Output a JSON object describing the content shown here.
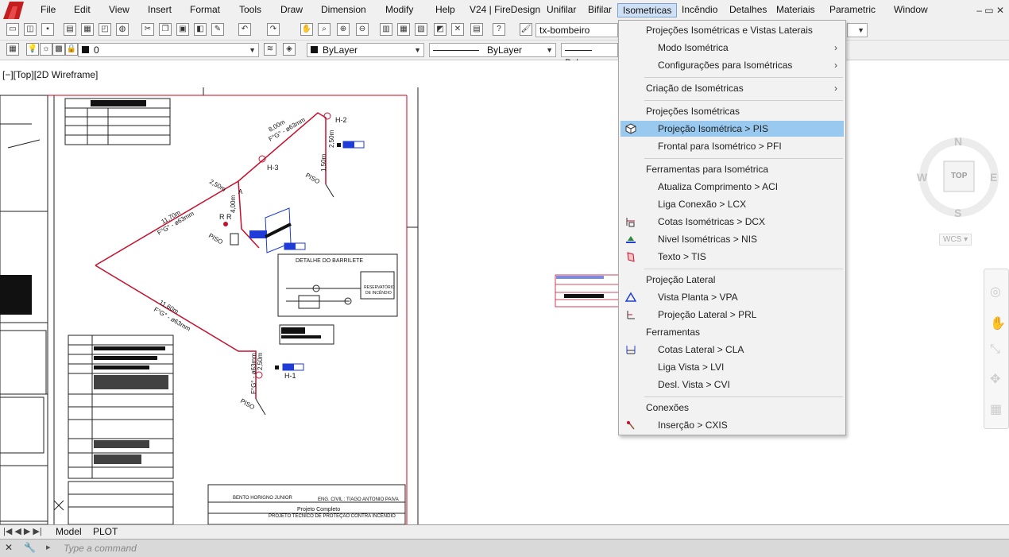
{
  "menubar": {
    "items": [
      "File",
      "Edit",
      "View",
      "Insert",
      "Format",
      "Tools",
      "Draw",
      "Dimension",
      "Modify",
      "Help",
      "V24 | FireDesign",
      "Unifilar",
      "Bifilar",
      "Isometricas",
      "Incêndio",
      "Detalhes",
      "Materiais",
      "Parametric",
      "Window"
    ],
    "active": "Isometricas"
  },
  "toolbar1": {
    "textstyle_value": "tx-bombeiro"
  },
  "toolbar2": {
    "layer_value": "0",
    "color_value": "ByLayer",
    "linetype_value": "ByLayer",
    "lineweight_value": "ByLa"
  },
  "viewport": {
    "label": "[−][Top][2D Wireframe]"
  },
  "viewcube": {
    "north": "N",
    "south": "S",
    "east": "E",
    "west": "W",
    "face": "TOP",
    "ucs": "WCS"
  },
  "layout_tabs": [
    "Model",
    "PLOT"
  ],
  "command": {
    "placeholder": "Type a command"
  },
  "menu": {
    "items": [
      {
        "label": "Projeções Isométricas e Vistas Laterais",
        "type": "group"
      },
      {
        "label": "Modo Isométrica",
        "submenu": true
      },
      {
        "label": "Configurações para Isométricas",
        "submenu": true
      },
      {
        "label": "Criação de Isométricas",
        "type": "group",
        "submenu": true
      },
      {
        "label": "Projeções Isométricas",
        "type": "group"
      },
      {
        "label": "Projeção Isométrica > PIS",
        "icon": "cube-icon",
        "highlighted": true
      },
      {
        "label": "Frontal para Isométrico > PFI"
      },
      {
        "label": "Ferramentas para Isométrica",
        "type": "group"
      },
      {
        "label": "Atualiza Comprimento > ACI"
      },
      {
        "label": "Liga Conexão > LCX"
      },
      {
        "label": "Cotas Isométricas > DCX",
        "icon": "iso-dimension-icon"
      },
      {
        "label": "Nivel Isométricas > NIS",
        "icon": "level-icon"
      },
      {
        "label": "Texto > TIS",
        "icon": "text-iso-icon"
      },
      {
        "label": "Projeção Lateral",
        "type": "group"
      },
      {
        "label": "Vista Planta > VPA",
        "icon": "plan-view-icon"
      },
      {
        "label": "Projeção Lateral > PRL",
        "icon": "lateral-projection-icon"
      },
      {
        "label": "Ferramentas",
        "type": "group"
      },
      {
        "label": "Cotas Lateral > CLA",
        "icon": "lateral-dimension-icon"
      },
      {
        "label": "Liga Vista > LVI"
      },
      {
        "label": "Desl. Vista > CVI"
      },
      {
        "label": "Conexões",
        "type": "group"
      },
      {
        "label": "Inserção > CXIS",
        "icon": "insert-connection-icon"
      }
    ]
  },
  "drawing": {
    "labels": {
      "h2": "H-2",
      "h3": "H-3",
      "h1": "H-1",
      "rr": "R R",
      "detalhe": "DETALHE DO BARRILETE",
      "reservatorio": "RESERVATÓRIO DE INCÊNDIO",
      "dim1": "8,00m",
      "dim2": "F°G° - ø63mm",
      "dim3": "11,70m",
      "dim4": "11,60m",
      "dim5": "4,00m",
      "dim6": "2,50m",
      "dim7": "1,50m",
      "piso": "PISO",
      "a": "A",
      "proj_title": "Projeto Completo",
      "owner": "BENTO HORIGNO JUNIOR",
      "eng": "ENG. CIVIL : TIAGO ANTONIO PAIVA",
      "subject": "PROJETO TECNICO DE PROTEÇÃO CONTRA INCÊNDIO"
    }
  },
  "colors": {
    "menu_highlight": "#99c9ef",
    "pipe_red": "#c8102e",
    "frame_red": "#d0021b",
    "blue_block": "#1f3dd6"
  }
}
